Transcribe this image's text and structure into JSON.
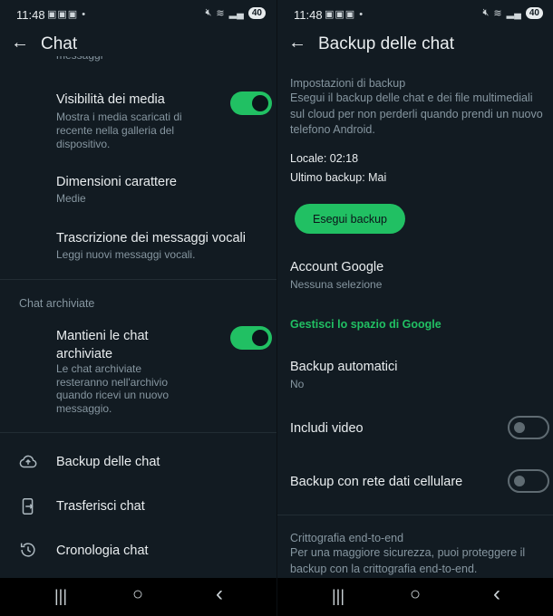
{
  "status": {
    "time": "11:48",
    "notif_icons": "▣▣▣ •",
    "battery": "40"
  },
  "left": {
    "title": "Chat",
    "clipped_text": "messaggi",
    "media_visibility": {
      "title": "Visibilità dei media",
      "subtitle": "Mostra i media scaricati di recente nella galleria del dispositivo.",
      "enabled": true
    },
    "font_size": {
      "title": "Dimensioni carattere",
      "value": "Medie"
    },
    "voice_transcription": {
      "title": "Trascrizione dei messaggi vocali",
      "subtitle": "Leggi nuovi messaggi vocali."
    },
    "archived_section": "Chat archiviate",
    "keep_archived": {
      "title": "Mantieni le chat archiviate",
      "subtitle": "Le chat archiviate resteranno nell'archivio quando ricevi un nuovo messaggio.",
      "enabled": true
    },
    "menu": [
      {
        "label": "Backup delle chat",
        "icon": "cloud-upload-icon"
      },
      {
        "label": "Trasferisci chat",
        "icon": "phone-transfer-icon"
      },
      {
        "label": "Cronologia chat",
        "icon": "history-icon"
      }
    ]
  },
  "right": {
    "title": "Backup delle chat",
    "settings_section": "Impostazioni di backup",
    "settings_desc": "Esegui il backup delle chat e dei file multimediali sul cloud per non perderli quando prendi un nuovo telefono Android.",
    "local": "Locale: 02:18",
    "last_backup": "Ultimo backup: Mai",
    "backup_button": "Esegui backup",
    "google_account": {
      "title": "Account Google",
      "value": "Nessuna selezione"
    },
    "manage_storage": "Gestisci lo spazio di Google",
    "auto_backup": {
      "title": "Backup automatici",
      "value": "No"
    },
    "include_video": {
      "title": "Includi video",
      "enabled": false
    },
    "cellular_backup": {
      "title": "Backup con rete dati cellulare",
      "enabled": false
    },
    "e2e_section": "Crittografia end-to-end",
    "e2e_desc": "Per una maggiore sicurezza, puoi proteggere il backup con la crittografia end-to-end."
  },
  "navbar": {
    "recents": "|||",
    "home": "○",
    "back": "‹"
  },
  "colors": {
    "background": "#121b22",
    "accent": "#21c063",
    "secondary_text": "#8696a0"
  }
}
